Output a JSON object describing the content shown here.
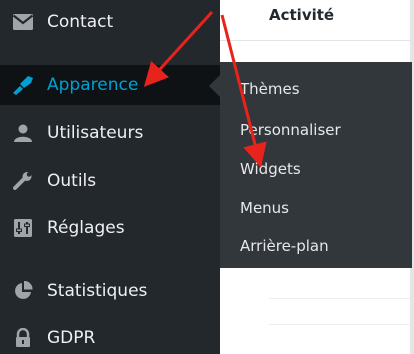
{
  "sidebar": {
    "items": [
      {
        "label": "Contact",
        "icon": "mail-icon"
      },
      {
        "label": "Apparence",
        "icon": "paintbrush-icon",
        "active": true
      },
      {
        "label": "Utilisateurs",
        "icon": "user-icon"
      },
      {
        "label": "Outils",
        "icon": "wrench-icon"
      },
      {
        "label": "Réglages",
        "icon": "settings-icon"
      },
      {
        "label": "Statistiques",
        "icon": "pie-chart-icon"
      },
      {
        "label": "GDPR",
        "icon": "lock-icon"
      }
    ]
  },
  "submenu": {
    "items": [
      "Thèmes",
      "Personnaliser",
      "Widgets",
      "Menus",
      "Arrière-plan"
    ]
  },
  "content": {
    "title": "Activité"
  },
  "colors": {
    "sidebar_bg": "#23282d",
    "submenu_bg": "#32373c",
    "active_text": "#00a0d2",
    "arrow": "#e8231c"
  }
}
